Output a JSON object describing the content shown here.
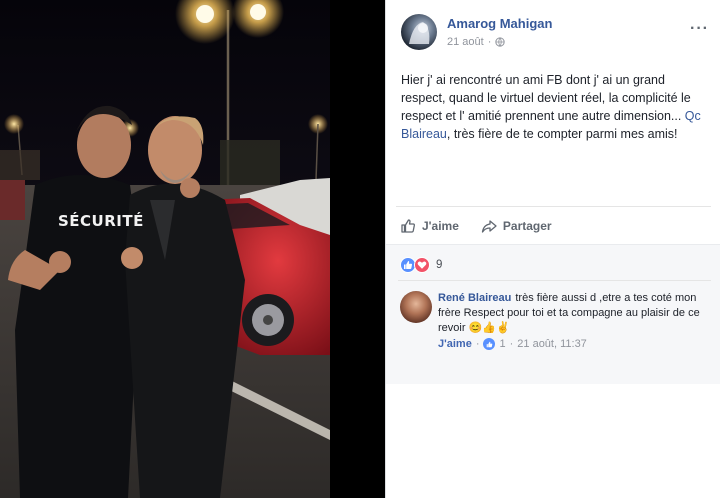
{
  "post": {
    "author": "Amarog Mahigan",
    "date": "21 août",
    "privacy_icon": "globe-icon",
    "more": "···",
    "text_before_mention": "Hier j' ai rencontré un ami FB dont j' ai un grand respect, quand le virtuel devient réel, la complicité le respect et l' amitié prennent une autre dimension... ",
    "mention": "Qc Blaireau",
    "text_after_mention": ", très fière de te compter parmi mes amis!"
  },
  "photo": {
    "shirt_text": "SÉCURITÉ"
  },
  "actions": {
    "like_label": "J'aime",
    "share_label": "Partager"
  },
  "reactions": {
    "count": "9",
    "types": [
      "like",
      "love"
    ]
  },
  "comment": {
    "author": "René Blaireau",
    "text": "très fière aussi d ,etre a tes coté mon frère Respect pour toi et ta compagne au plaisir de ce revoir",
    "emojis": "😊👍✌️",
    "like_label": "J'aime",
    "likes": "1",
    "timestamp": "21 août, 11:37"
  },
  "colors": {
    "link": "#365899",
    "text": "#1d2129",
    "muted": "#90949c",
    "like_blue": "#5890ff",
    "love_red": "#f25268"
  }
}
